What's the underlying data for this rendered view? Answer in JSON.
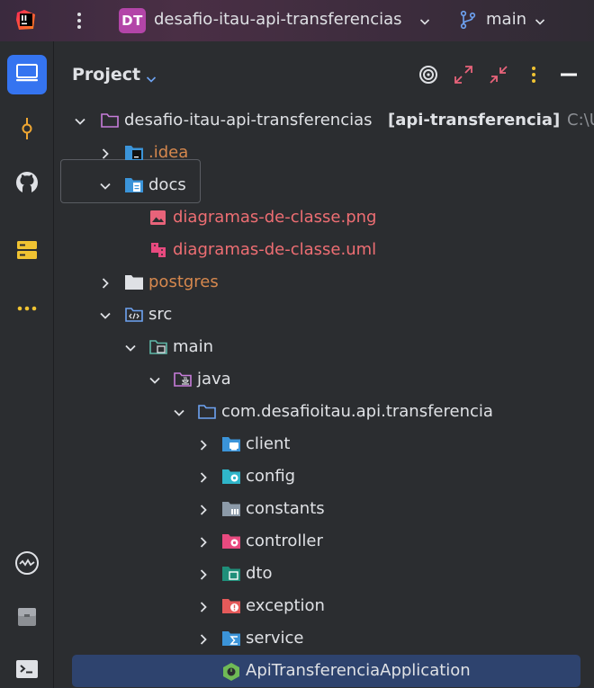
{
  "titlebar": {
    "project_badge": "DT",
    "project_name": "desafio-itau-api-transferencias",
    "branch_name": "main"
  },
  "panel": {
    "title": "Project"
  },
  "tree": {
    "root_label": "desafio-itau-api-transferencias",
    "root_module": "[api-transferencia]",
    "root_path": "C:\\U",
    "idea": ".idea",
    "docs": "docs",
    "png": "diagramas-de-classe.png",
    "uml": "diagramas-de-classe.uml",
    "postgres": "postgres",
    "src": "src",
    "main": "main",
    "java": "java",
    "package": "com.desafioitau.api.transferencia",
    "client": "client",
    "config": "config",
    "constants": "constants",
    "controller": "controller",
    "dto": "dto",
    "exception": "exception",
    "service": "service",
    "app": "ApiTransferenciaApplication"
  },
  "colors": {
    "accent": "#3574f0",
    "selection": "#2e436e",
    "excluded_orange": "#d6884e",
    "untracked_red": "#ee6e73",
    "text": "#dfe1e5"
  }
}
